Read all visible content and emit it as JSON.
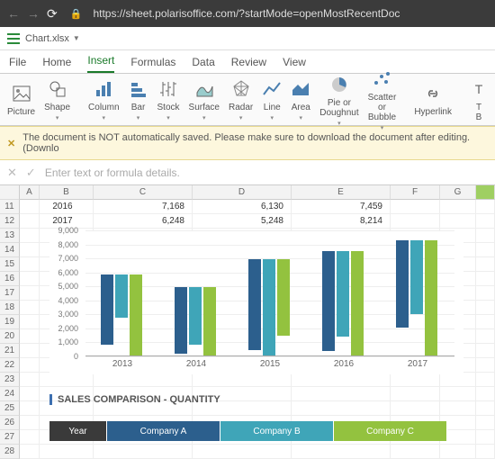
{
  "browser": {
    "url": "https://sheet.polarisoffice.com/?startMode=openMostRecentDoc"
  },
  "filename": "Chart.xlsx",
  "menu": {
    "tabs": [
      "File",
      "Home",
      "Insert",
      "Formulas",
      "Data",
      "Review",
      "View"
    ],
    "active": 2
  },
  "ribbon": [
    {
      "label": "Picture",
      "dd": false
    },
    {
      "label": "Shape",
      "dd": true
    },
    {
      "sep": true
    },
    {
      "label": "Column",
      "dd": true
    },
    {
      "label": "Bar",
      "dd": true
    },
    {
      "label": "Stock",
      "dd": true
    },
    {
      "label": "Surface",
      "dd": true
    },
    {
      "label": "Radar",
      "dd": true
    },
    {
      "label": "Line",
      "dd": true
    },
    {
      "label": "Area",
      "dd": true
    },
    {
      "label": "Pie or\nDoughnut",
      "dd": true
    },
    {
      "label": "Scatter\nor Bubble",
      "dd": true
    },
    {
      "sep": true
    },
    {
      "label": "Hyperlink",
      "dd": false
    },
    {
      "sep": true
    },
    {
      "label": "T\nB",
      "dd": false
    }
  ],
  "warning": "The document is NOT automatically saved. Please make sure to download the document after editing. (Downlo",
  "formula_placeholder": "Enter text or formula details.",
  "columns": [
    "A",
    "B",
    "C",
    "D",
    "E",
    "F",
    "G",
    ""
  ],
  "row_start": 11,
  "data_rows": [
    {
      "r": 11,
      "B": "2016",
      "C": "7,168",
      "D": "6,130",
      "E": "7,459"
    },
    {
      "r": 12,
      "B": "2017",
      "C": "6,248",
      "D": "5,248",
      "E": "8,214"
    }
  ],
  "blank_rows": [
    13,
    14,
    15,
    16,
    17,
    18,
    19,
    20,
    21,
    22,
    23,
    24,
    25,
    26,
    27,
    28
  ],
  "section_title": "SALES COMPARISON - QUANTITY",
  "table2_headers": [
    "Year",
    "Company A",
    "Company B",
    "Company C"
  ],
  "chart_data": {
    "type": "bar",
    "categories": [
      "2013",
      "2014",
      "2015",
      "2016",
      "2017"
    ],
    "series": [
      {
        "name": "Company A",
        "color": "#2c5f8d",
        "values": [
          5000,
          4800,
          6500,
          7168,
          6248
        ]
      },
      {
        "name": "Company B",
        "color": "#3fa5b8",
        "values": [
          3100,
          4100,
          6900,
          6130,
          5248
        ]
      },
      {
        "name": "Company C",
        "color": "#93c23f",
        "values": [
          5800,
          4900,
          5500,
          7459,
          8214
        ]
      }
    ],
    "ylim": [
      0,
      9000
    ],
    "yticks": [
      0,
      1000,
      2000,
      3000,
      4000,
      5000,
      6000,
      7000,
      8000,
      9000
    ],
    "yticklabels": [
      "0",
      "1,000",
      "2,000",
      "3,000",
      "4,000",
      "5,000",
      "6,000",
      "7,000",
      "8,000",
      "9,000"
    ]
  }
}
